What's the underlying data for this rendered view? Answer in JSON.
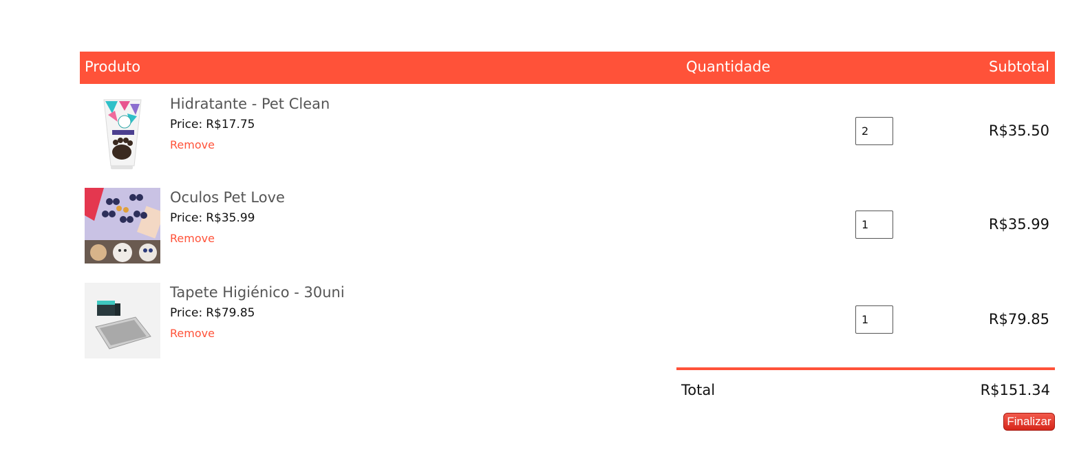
{
  "header": {
    "product_label": "Produto",
    "quantity_label": "Quantidade",
    "subtotal_label": "Subtotal"
  },
  "items": [
    {
      "name": "Hidratante - Pet Clean",
      "price_label": "Price:",
      "price": "R$17.75",
      "remove_label": "Remove",
      "quantity": "2",
      "subtotal": "R$35.50",
      "image_icon": "moisturizer-tube-image"
    },
    {
      "name": "Oculos Pet Love",
      "price_label": "Price:",
      "price": "R$35.99",
      "remove_label": "Remove",
      "quantity": "1",
      "subtotal": "R$35.99",
      "image_icon": "pet-sunglasses-image"
    },
    {
      "name": "Tapete Higiénico - 30uni",
      "price_label": "Price:",
      "price": "R$79.85",
      "remove_label": "Remove",
      "quantity": "1",
      "subtotal": "R$79.85",
      "image_icon": "hygienic-pad-image"
    }
  ],
  "totals": {
    "label": "Total",
    "value": "R$151.34"
  },
  "actions": {
    "checkout_label": "Finalizar"
  },
  "colors": {
    "accent": "#ff5239",
    "text": "#111111",
    "muted_text": "#555555"
  }
}
